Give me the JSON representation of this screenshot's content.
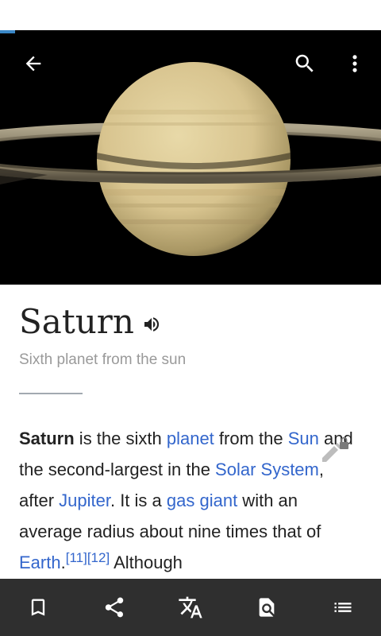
{
  "progress": {
    "value": 0.04
  },
  "lead_image": {
    "subject": "saturn-planet-image"
  },
  "toolbar": {
    "back_icon": "arrow-left-icon",
    "search_icon": "search-icon",
    "more_icon": "more-vertical-icon"
  },
  "article": {
    "title": "Saturn",
    "description": "Sixth planet from the sun",
    "body": {
      "p1_bold": "Saturn",
      "t1": " is the sixth ",
      "link_planet": "planet",
      "t2": " from the ",
      "link_sun": "Sun",
      "t3": " and the second-largest in the ",
      "link_solar_system": "Solar System",
      "t4": ", after ",
      "link_jupiter": "Jupiter",
      "t5": ". It is a ",
      "link_gas_giant": "gas giant",
      "t6": " with an average radius about nine times that of ",
      "link_earth": "Earth",
      "t7": ".",
      "ref1": "[11]",
      "ref2": "[12]",
      "t8": " Although"
    }
  },
  "bottom_bar": [
    {
      "name": "save-button",
      "icon": "bookmark-icon"
    },
    {
      "name": "share-button",
      "icon": "share-icon"
    },
    {
      "name": "language-button",
      "icon": "translate-icon"
    },
    {
      "name": "find-in-page-button",
      "icon": "find-in-page-icon"
    },
    {
      "name": "contents-button",
      "icon": "list-icon"
    }
  ],
  "colors": {
    "link": "#3366cc",
    "bottom_bar": "#2f2f2f",
    "progress": "#3a87c7"
  }
}
